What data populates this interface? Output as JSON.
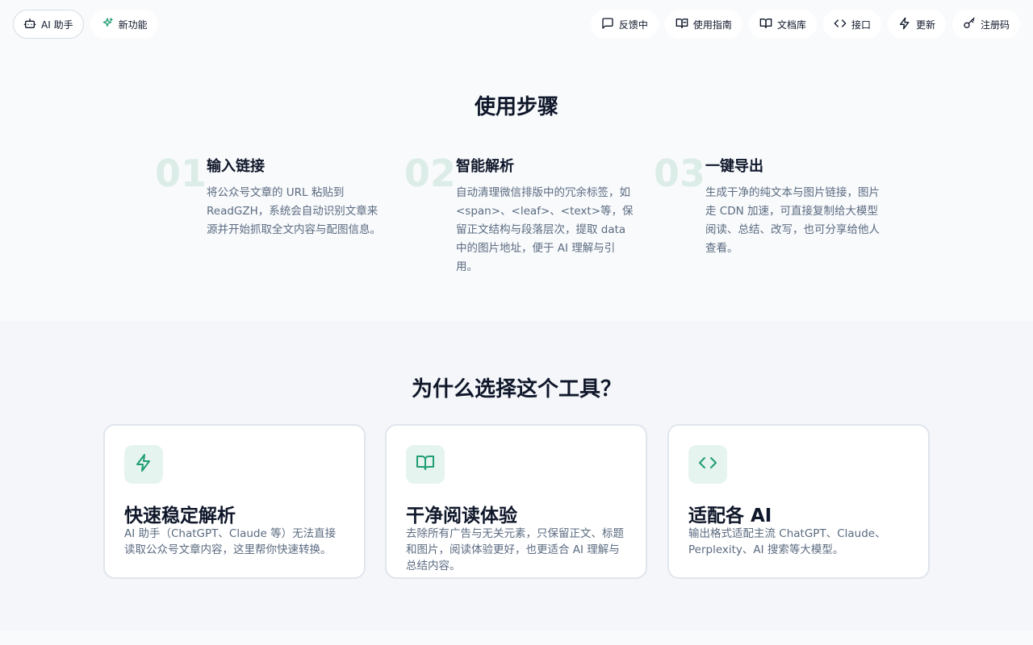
{
  "topbar": {
    "left": [
      {
        "label": "AI 助手",
        "icon": "robot-icon"
      },
      {
        "label": "新功能",
        "icon": "sparkle-icon"
      }
    ],
    "right": [
      {
        "label": "反馈中",
        "icon": "message-icon"
      },
      {
        "label": "使用指南",
        "icon": "book-open-icon"
      },
      {
        "label": "文档库",
        "icon": "book-icon"
      },
      {
        "label": "接口",
        "icon": "code-icon"
      },
      {
        "label": "更新",
        "icon": "zap-icon"
      },
      {
        "label": "注册码",
        "icon": "key-icon"
      }
    ]
  },
  "steps_section": {
    "title": "使用步骤",
    "steps": [
      {
        "num": "01",
        "title": "输入链接",
        "desc": "将公众号文章的 URL 粘贴到 ReadGZH，系统会自动识别文章来源并开始抓取全文内容与配图信息。"
      },
      {
        "num": "02",
        "title": "智能解析",
        "desc": "自动清理微信排版中的冗余标签，如<span>、<leaf>、<text>等，保留正文结构与段落层次，提取 data 中的图片地址，便于 AI 理解与引用。"
      },
      {
        "num": "03",
        "title": "一键导出",
        "desc": "生成干净的纯文本与图片链接，图片走 CDN 加速，可直接复制给大模型阅读、总结、改写，也可分享给他人查看。"
      }
    ]
  },
  "features_section": {
    "title": "为什么选择这个工具？",
    "cards": [
      {
        "icon": "zap-icon",
        "title": "快速稳定解析",
        "desc": "AI 助手（ChatGPT、Claude 等）无法直接读取公众号文章内容，这里帮你快速转换。"
      },
      {
        "icon": "book-open-icon",
        "title": "干净阅读体验",
        "desc": "去除所有广告与无关元素，只保留正文、标题和图片，阅读体验更好，也更适合 AI 理解与总结内容。"
      },
      {
        "icon": "code-icon",
        "title": "适配各 AI",
        "desc": "输出格式适配主流 ChatGPT、Claude、Perplexity、AI 搜索等大模型。"
      }
    ]
  },
  "colors": {
    "accent": "#1f9d74",
    "accent_soft": "#e6f4ef",
    "step_number": "#dcece7",
    "text": "#0f172a",
    "muted": "#5b6b80"
  }
}
